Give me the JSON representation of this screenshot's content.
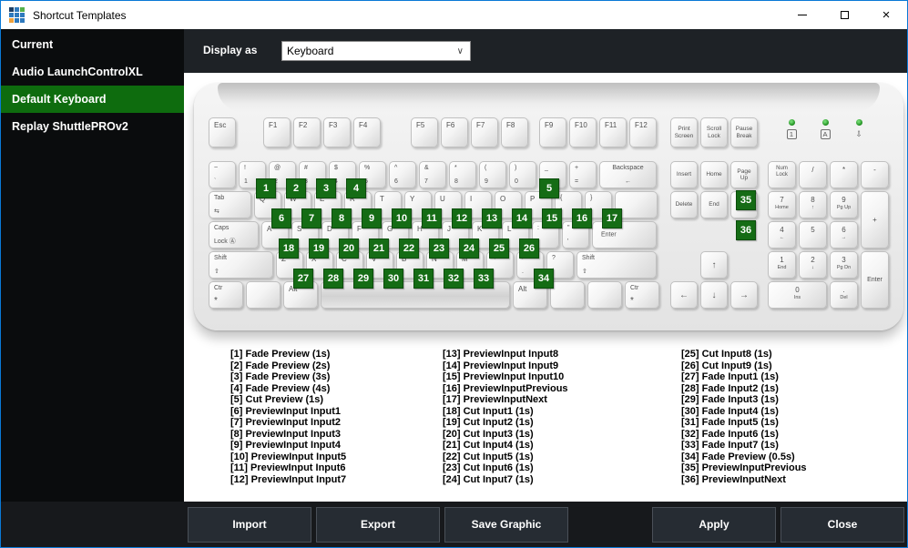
{
  "titlebar": {
    "title": "Shortcut Templates",
    "icon_colors": [
      "#1d3f66",
      "#2e79bd",
      "#55b04a",
      "#2e79bd",
      "#2e79bd",
      "#2e79bd",
      "#f0a13a",
      "#2e79bd",
      "#2e79bd"
    ]
  },
  "sidebar": {
    "items": [
      {
        "label": "Current",
        "selected": false
      },
      {
        "label": "Audio LaunchControlXL",
        "selected": false
      },
      {
        "label": "Default Keyboard",
        "selected": true
      },
      {
        "label": "Replay ShuttlePROv2",
        "selected": false
      }
    ]
  },
  "topbar": {
    "display_as_label": "Display as",
    "display_as_value": "Keyboard"
  },
  "colors": {
    "window_border": "#0a79d6",
    "selected_green": "#0e6c0e",
    "badge_green": "#156c15",
    "led_green": "#229222"
  },
  "keyboard": {
    "esc": {
      "c": "Esc"
    },
    "fgroups": [
      [
        "F1",
        "F2",
        "F3",
        "F4"
      ],
      [
        "F5",
        "F6",
        "F7",
        "F8"
      ],
      [
        "F9",
        "F10",
        "F11",
        "F12"
      ]
    ],
    "syskeys": [
      {
        "t": "Print",
        "b": "Screen"
      },
      {
        "t": "Scroll",
        "b": "Lock"
      },
      {
        "t": "Pause",
        "b": "Break"
      }
    ],
    "leds": [
      {
        "label": "1",
        "boxed": true
      },
      {
        "label": "A",
        "boxed": true
      },
      {
        "label": "⇩",
        "boxed": false
      }
    ],
    "rows": [
      [
        {
          "t": "~",
          "b": "`"
        },
        {
          "t": "!",
          "b": "1",
          "badge": 1
        },
        {
          "t": "@",
          "b": "2",
          "badge": 2
        },
        {
          "t": "#",
          "b": "3",
          "badge": 3
        },
        {
          "t": "$",
          "b": "4",
          "badge": 4
        },
        {
          "t": "%",
          "b": "5"
        },
        {
          "t": "^",
          "b": "6"
        },
        {
          "t": "&",
          "b": "7"
        },
        {
          "t": "*",
          "b": "8"
        },
        {
          "t": "(",
          "b": "9"
        },
        {
          "t": ")",
          "b": "0",
          "badge": 5,
          "bofs": 14
        },
        {
          "t": "_",
          "b": "-"
        },
        {
          "t": "+",
          "b": "="
        },
        {
          "t": "Backspace",
          "b": "←",
          "w": 2,
          "cls": "center"
        }
      ],
      [
        {
          "t": "Tab",
          "b": "⇆",
          "w": 1.5
        },
        {
          "c": "Q",
          "badge": 6
        },
        {
          "c": "W",
          "badge": 7
        },
        {
          "c": "E",
          "badge": 8
        },
        {
          "c": "R",
          "badge": 9
        },
        {
          "c": "T",
          "badge": 10
        },
        {
          "c": "Y",
          "badge": 11
        },
        {
          "c": "U",
          "badge": 12
        },
        {
          "c": "I",
          "badge": 13
        },
        {
          "c": "O",
          "badge": 14
        },
        {
          "c": "P",
          "badge": 15
        },
        {
          "t": "{",
          "b": "[",
          "badge": 16
        },
        {
          "t": "}",
          "b": "]",
          "badge": 17
        },
        {
          "w": 1.5
        }
      ],
      [
        {
          "t": "Caps",
          "b": "Lock Ⓐ",
          "w": 1.75
        },
        {
          "c": "A",
          "badge": 18
        },
        {
          "c": "S",
          "badge": 19
        },
        {
          "c": "D",
          "badge": 20
        },
        {
          "c": "F",
          "badge": 21
        },
        {
          "c": "G",
          "badge": 22
        },
        {
          "c": "H",
          "badge": 23
        },
        {
          "c": "J",
          "badge": 24
        },
        {
          "c": "K",
          "badge": 25
        },
        {
          "c": "L",
          "badge": 26
        },
        {
          "t": ":",
          "b": ";"
        },
        {
          "t": "\"",
          "b": "'"
        },
        {
          "c": "Enter",
          "w": 2.25,
          "cls": "vcenter"
        }
      ],
      [
        {
          "t": "Shift",
          "b": "⇧",
          "w": 2.25
        },
        {
          "c": "Z",
          "badge": 27
        },
        {
          "c": "X",
          "badge": 28
        },
        {
          "c": "C",
          "badge": 29
        },
        {
          "c": "V",
          "badge": 30
        },
        {
          "c": "B",
          "badge": 31
        },
        {
          "c": "N",
          "badge": 32
        },
        {
          "c": "M",
          "badge": 33
        },
        {
          "t": "<",
          "b": ","
        },
        {
          "t": ">",
          "b": ".",
          "badge": 34
        },
        {
          "t": "?",
          "b": "/"
        },
        {
          "t": "Shift",
          "b": "⇧",
          "w": 2.75
        }
      ],
      [
        {
          "t": "Ctr",
          "b": "*",
          "w": 1.25,
          "cls": "ctr"
        },
        {
          "w": 1.25
        },
        {
          "c": "Alt",
          "w": 1.25
        },
        {
          "space": true
        },
        {
          "c": "Alt",
          "w": 1.25
        },
        {
          "w": 1.25
        },
        {
          "w": 1.25
        },
        {
          "t": "Ctr",
          "b": "*",
          "w": 1.25,
          "cls": "ctr"
        }
      ]
    ],
    "nav_rows": [
      [
        {
          "c": "Insert"
        },
        {
          "c": "Home"
        },
        {
          "t": "Page",
          "b": "Up",
          "badge": 35
        }
      ],
      [
        {
          "c": "Delete"
        },
        {
          "c": "End"
        },
        {
          "t": "Page",
          "b": "Down",
          "badge": 36
        }
      ]
    ],
    "arrows": {
      "up": "↑",
      "left": "←",
      "down": "↓",
      "right": "→"
    },
    "numpad": [
      {
        "t": "Num",
        "b": "Lock"
      },
      {
        "c": "/"
      },
      {
        "c": "*"
      },
      {
        "c": "-"
      },
      {
        "c": "7",
        "sub": "Home"
      },
      {
        "c": "8",
        "sub": "↑"
      },
      {
        "c": "9",
        "sub": "Pg Up"
      },
      {
        "c": "+",
        "tall": true
      },
      {
        "c": "4",
        "sub": "←"
      },
      {
        "c": "5"
      },
      {
        "c": "6",
        "sub": "→"
      },
      {
        "c": "1",
        "sub": "End"
      },
      {
        "c": "2",
        "sub": "↓"
      },
      {
        "c": "3",
        "sub": "Pg Dn"
      },
      {
        "c": "Enter",
        "tall": true,
        "small": true
      },
      {
        "c": "0",
        "sub": "Ins",
        "wide": true
      },
      {
        "c": ".",
        "sub": "Del"
      }
    ]
  },
  "legend": {
    "columns": [
      [
        "[1] Fade Preview (1s)",
        "[2] Fade Preview (2s)",
        "[3] Fade Preview (3s)",
        "[4] Fade Preview (4s)",
        "[5] Cut Preview (1s)",
        "[6] PreviewInput Input1",
        "[7] PreviewInput Input2",
        "[8] PreviewInput Input3",
        "[9] PreviewInput Input4",
        "[10] PreviewInput Input5",
        "[11] PreviewInput Input6",
        "[12] PreviewInput Input7"
      ],
      [
        "[13] PreviewInput Input8",
        "[14] PreviewInput Input9",
        "[15] PreviewInput Input10",
        "[16] PreviewInputPrevious",
        "[17] PreviewInputNext",
        "[18] Cut Input1 (1s)",
        "[19] Cut Input2 (1s)",
        "[20] Cut Input3 (1s)",
        "[21] Cut Input4 (1s)",
        "[22] Cut Input5 (1s)",
        "[23] Cut Input6 (1s)",
        "[24] Cut Input7 (1s)"
      ],
      [
        "[25] Cut Input8 (1s)",
        "[26] Cut Input9 (1s)",
        "[27] Fade Input1 (1s)",
        "[28] Fade Input2 (1s)",
        "[29] Fade Input3 (1s)",
        "[30] Fade Input4 (1s)",
        "[31] Fade Input5 (1s)",
        "[32] Fade Input6 (1s)",
        "[33] Fade Input7 (1s)",
        "[34] Fade Preview (0.5s)",
        "[35] PreviewInputPrevious",
        "[36] PreviewInputNext"
      ]
    ]
  },
  "footer": {
    "left_buttons": [
      "Import",
      "Export",
      "Save Graphic"
    ],
    "right_buttons": [
      "Apply",
      "Close"
    ]
  }
}
